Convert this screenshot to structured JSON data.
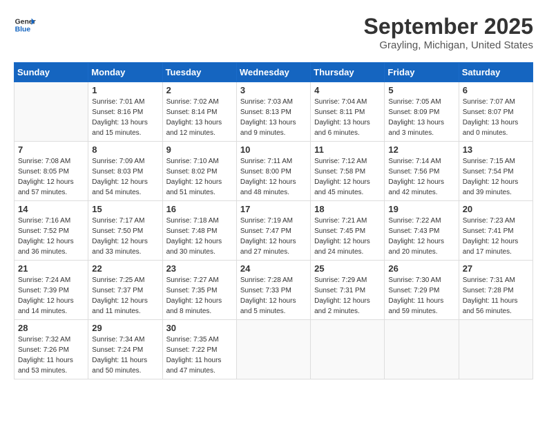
{
  "header": {
    "logo_line1": "General",
    "logo_line2": "Blue",
    "month_title": "September 2025",
    "location": "Grayling, Michigan, United States"
  },
  "weekdays": [
    "Sunday",
    "Monday",
    "Tuesday",
    "Wednesday",
    "Thursday",
    "Friday",
    "Saturday"
  ],
  "weeks": [
    [
      {
        "day": "",
        "sunrise": "",
        "sunset": "",
        "daylight": ""
      },
      {
        "day": "1",
        "sunrise": "Sunrise: 7:01 AM",
        "sunset": "Sunset: 8:16 PM",
        "daylight": "Daylight: 13 hours and 15 minutes."
      },
      {
        "day": "2",
        "sunrise": "Sunrise: 7:02 AM",
        "sunset": "Sunset: 8:14 PM",
        "daylight": "Daylight: 13 hours and 12 minutes."
      },
      {
        "day": "3",
        "sunrise": "Sunrise: 7:03 AM",
        "sunset": "Sunset: 8:13 PM",
        "daylight": "Daylight: 13 hours and 9 minutes."
      },
      {
        "day": "4",
        "sunrise": "Sunrise: 7:04 AM",
        "sunset": "Sunset: 8:11 PM",
        "daylight": "Daylight: 13 hours and 6 minutes."
      },
      {
        "day": "5",
        "sunrise": "Sunrise: 7:05 AM",
        "sunset": "Sunset: 8:09 PM",
        "daylight": "Daylight: 13 hours and 3 minutes."
      },
      {
        "day": "6",
        "sunrise": "Sunrise: 7:07 AM",
        "sunset": "Sunset: 8:07 PM",
        "daylight": "Daylight: 13 hours and 0 minutes."
      }
    ],
    [
      {
        "day": "7",
        "sunrise": "Sunrise: 7:08 AM",
        "sunset": "Sunset: 8:05 PM",
        "daylight": "Daylight: 12 hours and 57 minutes."
      },
      {
        "day": "8",
        "sunrise": "Sunrise: 7:09 AM",
        "sunset": "Sunset: 8:03 PM",
        "daylight": "Daylight: 12 hours and 54 minutes."
      },
      {
        "day": "9",
        "sunrise": "Sunrise: 7:10 AM",
        "sunset": "Sunset: 8:02 PM",
        "daylight": "Daylight: 12 hours and 51 minutes."
      },
      {
        "day": "10",
        "sunrise": "Sunrise: 7:11 AM",
        "sunset": "Sunset: 8:00 PM",
        "daylight": "Daylight: 12 hours and 48 minutes."
      },
      {
        "day": "11",
        "sunrise": "Sunrise: 7:12 AM",
        "sunset": "Sunset: 7:58 PM",
        "daylight": "Daylight: 12 hours and 45 minutes."
      },
      {
        "day": "12",
        "sunrise": "Sunrise: 7:14 AM",
        "sunset": "Sunset: 7:56 PM",
        "daylight": "Daylight: 12 hours and 42 minutes."
      },
      {
        "day": "13",
        "sunrise": "Sunrise: 7:15 AM",
        "sunset": "Sunset: 7:54 PM",
        "daylight": "Daylight: 12 hours and 39 minutes."
      }
    ],
    [
      {
        "day": "14",
        "sunrise": "Sunrise: 7:16 AM",
        "sunset": "Sunset: 7:52 PM",
        "daylight": "Daylight: 12 hours and 36 minutes."
      },
      {
        "day": "15",
        "sunrise": "Sunrise: 7:17 AM",
        "sunset": "Sunset: 7:50 PM",
        "daylight": "Daylight: 12 hours and 33 minutes."
      },
      {
        "day": "16",
        "sunrise": "Sunrise: 7:18 AM",
        "sunset": "Sunset: 7:48 PM",
        "daylight": "Daylight: 12 hours and 30 minutes."
      },
      {
        "day": "17",
        "sunrise": "Sunrise: 7:19 AM",
        "sunset": "Sunset: 7:47 PM",
        "daylight": "Daylight: 12 hours and 27 minutes."
      },
      {
        "day": "18",
        "sunrise": "Sunrise: 7:21 AM",
        "sunset": "Sunset: 7:45 PM",
        "daylight": "Daylight: 12 hours and 24 minutes."
      },
      {
        "day": "19",
        "sunrise": "Sunrise: 7:22 AM",
        "sunset": "Sunset: 7:43 PM",
        "daylight": "Daylight: 12 hours and 20 minutes."
      },
      {
        "day": "20",
        "sunrise": "Sunrise: 7:23 AM",
        "sunset": "Sunset: 7:41 PM",
        "daylight": "Daylight: 12 hours and 17 minutes."
      }
    ],
    [
      {
        "day": "21",
        "sunrise": "Sunrise: 7:24 AM",
        "sunset": "Sunset: 7:39 PM",
        "daylight": "Daylight: 12 hours and 14 minutes."
      },
      {
        "day": "22",
        "sunrise": "Sunrise: 7:25 AM",
        "sunset": "Sunset: 7:37 PM",
        "daylight": "Daylight: 12 hours and 11 minutes."
      },
      {
        "day": "23",
        "sunrise": "Sunrise: 7:27 AM",
        "sunset": "Sunset: 7:35 PM",
        "daylight": "Daylight: 12 hours and 8 minutes."
      },
      {
        "day": "24",
        "sunrise": "Sunrise: 7:28 AM",
        "sunset": "Sunset: 7:33 PM",
        "daylight": "Daylight: 12 hours and 5 minutes."
      },
      {
        "day": "25",
        "sunrise": "Sunrise: 7:29 AM",
        "sunset": "Sunset: 7:31 PM",
        "daylight": "Daylight: 12 hours and 2 minutes."
      },
      {
        "day": "26",
        "sunrise": "Sunrise: 7:30 AM",
        "sunset": "Sunset: 7:29 PM",
        "daylight": "Daylight: 11 hours and 59 minutes."
      },
      {
        "day": "27",
        "sunrise": "Sunrise: 7:31 AM",
        "sunset": "Sunset: 7:28 PM",
        "daylight": "Daylight: 11 hours and 56 minutes."
      }
    ],
    [
      {
        "day": "28",
        "sunrise": "Sunrise: 7:32 AM",
        "sunset": "Sunset: 7:26 PM",
        "daylight": "Daylight: 11 hours and 53 minutes."
      },
      {
        "day": "29",
        "sunrise": "Sunrise: 7:34 AM",
        "sunset": "Sunset: 7:24 PM",
        "daylight": "Daylight: 11 hours and 50 minutes."
      },
      {
        "day": "30",
        "sunrise": "Sunrise: 7:35 AM",
        "sunset": "Sunset: 7:22 PM",
        "daylight": "Daylight: 11 hours and 47 minutes."
      },
      {
        "day": "",
        "sunrise": "",
        "sunset": "",
        "daylight": ""
      },
      {
        "day": "",
        "sunrise": "",
        "sunset": "",
        "daylight": ""
      },
      {
        "day": "",
        "sunrise": "",
        "sunset": "",
        "daylight": ""
      },
      {
        "day": "",
        "sunrise": "",
        "sunset": "",
        "daylight": ""
      }
    ]
  ]
}
